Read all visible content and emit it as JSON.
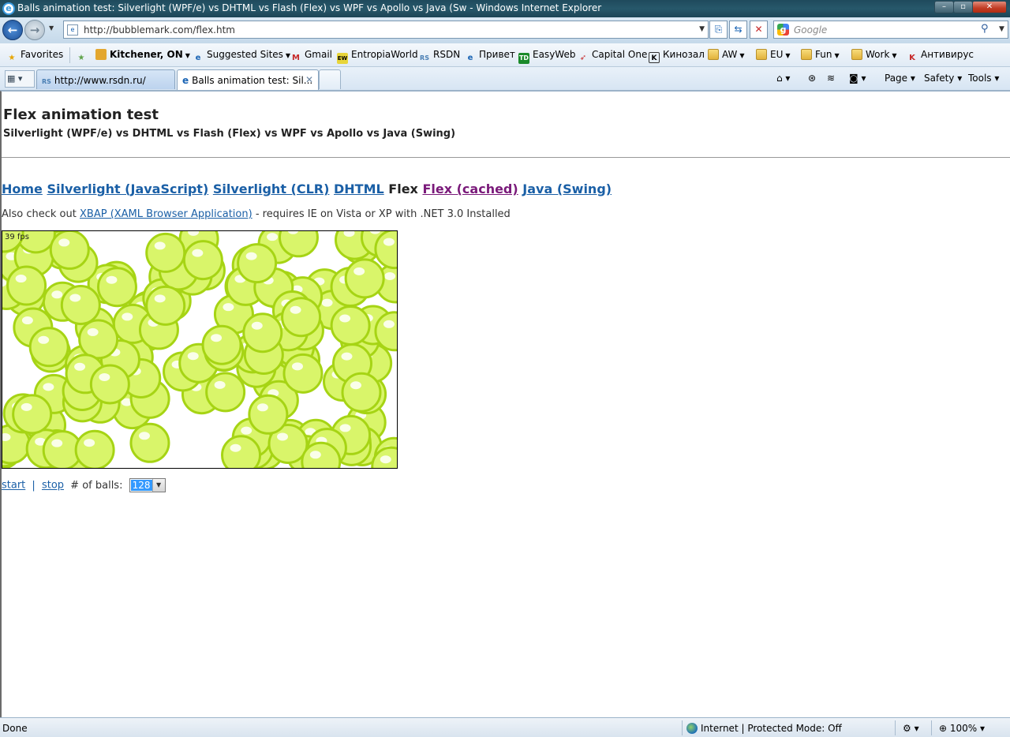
{
  "window": {
    "title": "Balls animation test: Silverlight (WPF/e) vs DHTML vs Flash (Flex) vs WPF vs Apollo vs Java (Sw - Windows Internet Explorer",
    "min": "–",
    "max": "▫",
    "close": "✕"
  },
  "toolbar": {
    "back_glyph": "←",
    "forward_glyph": "→",
    "address": "http://bubblemark.com/flex.htm",
    "search_placeholder": "Google"
  },
  "favorites": {
    "label": "Favorites",
    "items": [
      {
        "label": "Kitchener, ON"
      },
      {
        "label": "Suggested Sites"
      },
      {
        "label": "Gmail"
      },
      {
        "label": "EntropiaWorld"
      },
      {
        "label": "RSDN"
      },
      {
        "label": "Привет"
      },
      {
        "label": "EasyWeb"
      },
      {
        "label": "Capital One"
      },
      {
        "label": "Кинозал"
      },
      {
        "label": "AW"
      },
      {
        "label": "EU"
      },
      {
        "label": "Fun"
      },
      {
        "label": "Work"
      },
      {
        "label": "Антивирус"
      }
    ]
  },
  "tabs": [
    {
      "label": "http://www.rsdn.ru/"
    },
    {
      "label": "Balls animation test: Sil..."
    }
  ],
  "commands": {
    "page": "Page",
    "safety": "Safety",
    "tools": "Tools"
  },
  "page": {
    "title": "Flex animation test",
    "subtitle": "Silverlight (WPF/e) vs DHTML vs Flash (Flex) vs WPF vs Apollo vs Java (Swing)",
    "nav": {
      "home": "Home",
      "sl_js": "Silverlight (JavaScript)",
      "sl_clr": "Silverlight (CLR)",
      "dhtml": "DHTML",
      "flex": "Flex",
      "flex_cached": "Flex (cached)",
      "java": "Java (Swing)"
    },
    "check_prefix": "Also check out",
    "check_link": "XBAP (XAML Browser Application)",
    "check_suffix": "- requires IE on Vista or XP with .NET 3.0 Installed",
    "fps": "39 fps",
    "start": "start",
    "divider": "|",
    "stop": "stop",
    "balls_label": "# of balls:",
    "balls_value": "128"
  },
  "status": {
    "text": "Done",
    "zone": "Internet | Protected Mode: Off",
    "zoom": "100%"
  },
  "colors": {
    "ball_fill": "#d9f56a",
    "ball_edge": "#a6d414",
    "link": "#1a5fa6",
    "visited_link": "#7a1a7a"
  }
}
